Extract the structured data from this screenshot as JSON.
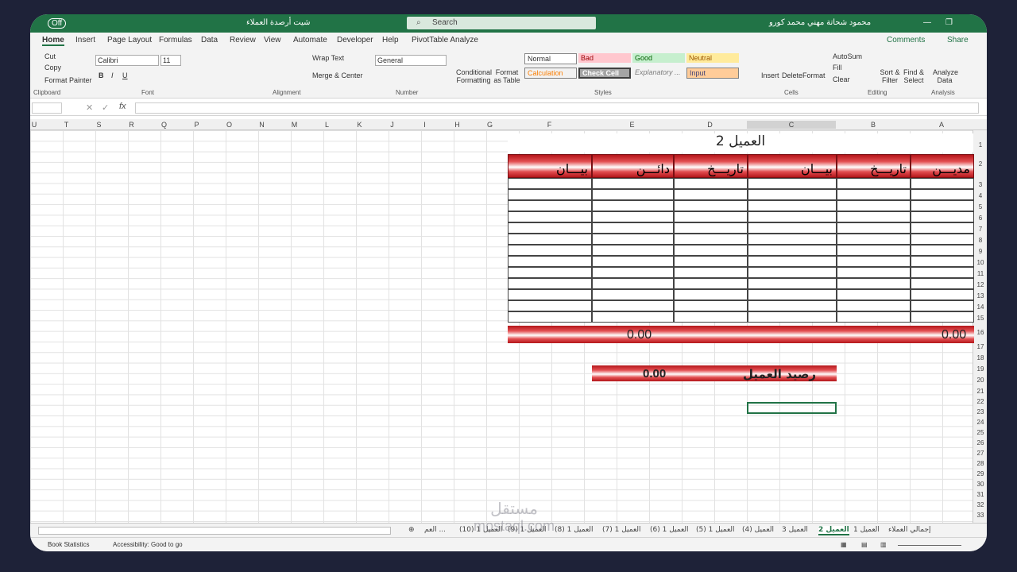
{
  "titlebar": {
    "autosave": "Off",
    "file_name": "شيت أرصدة العملاء",
    "search": "Search",
    "user": "محمود شحاتة مهني محمد كورو"
  },
  "ribbon_tabs": [
    "Home",
    "Insert",
    "Page Layout",
    "Formulas",
    "Data",
    "Review",
    "View",
    "Automate",
    "Developer",
    "Help",
    "PivotTable Analyze"
  ],
  "ribbon_right": {
    "comments": "Comments",
    "share": "Share"
  },
  "clipboard": {
    "cut": "Cut",
    "copy": "Copy",
    "painter": "Format Painter",
    "group": "Clipboard"
  },
  "font": {
    "name": "Calibri",
    "size": "11",
    "group": "Font"
  },
  "alignment": {
    "wrap": "Wrap Text",
    "merge": "Merge & Center",
    "group": "Alignment"
  },
  "number": {
    "format": "General",
    "group": "Number"
  },
  "styles": {
    "conditional": "Conditional Formatting",
    "format_table": "Format as Table",
    "normal": "Normal",
    "bad": "Bad",
    "good": "Good",
    "neutral": "Neutral",
    "calculation": "Calculation",
    "check": "Check Cell",
    "explanatory": "Explanatory ...",
    "input": "Input",
    "group": "Styles"
  },
  "cells": {
    "insert": "Insert",
    "delete": "Delete",
    "format": "Format",
    "group": "Cells"
  },
  "editing": {
    "autosum": "AutoSum",
    "fill": "Fill",
    "clear": "Clear",
    "sort": "Sort & Filter",
    "find": "Find & Select",
    "group": "Editing"
  },
  "analysis": {
    "analyze": "Analyze Data",
    "group": "Analysis"
  },
  "columns": [
    "U",
    "T",
    "S",
    "R",
    "Q",
    "P",
    "O",
    "N",
    "M",
    "L",
    "K",
    "J",
    "I",
    "H",
    "G",
    "F",
    "E",
    "D",
    "C",
    "B",
    "A"
  ],
  "rows": [
    "1",
    "2",
    "3",
    "4",
    "5",
    "6",
    "7",
    "8",
    "9",
    "10",
    "11",
    "12",
    "13",
    "14",
    "15",
    "16",
    "17",
    "18",
    "19",
    "20",
    "21",
    "22",
    "23",
    "24",
    "25",
    "26",
    "27",
    "28",
    "29",
    "30",
    "31",
    "32",
    "33"
  ],
  "sheet": {
    "title": "العميل 2",
    "headers": [
      "بيـــان",
      "دائـــن",
      "تاريـــخ",
      "بيـــان",
      "تاريـــخ",
      "مديـــن"
    ],
    "total_left": "0.00",
    "total_right": "0.00",
    "balance_label": "رصيد العميل",
    "balance_value": "0.00"
  },
  "sheet_tabs": [
    "إجمالي العملاء",
    "العميل 1",
    "العميل 2",
    "العميل 3",
    "العميل (4)",
    "العميل 1 (5)",
    "العميل 1 (6)",
    "العميل 1 (7)",
    "العميل 1 (8)",
    "العميل 1 (9)",
    "العميل 1 (10)",
    "العم ..."
  ],
  "status": {
    "stats": "Book Statistics",
    "accessibility": "Accessibility: Good to go"
  },
  "watermark": {
    "text": "مستقل",
    "url": "mostaql.com"
  }
}
